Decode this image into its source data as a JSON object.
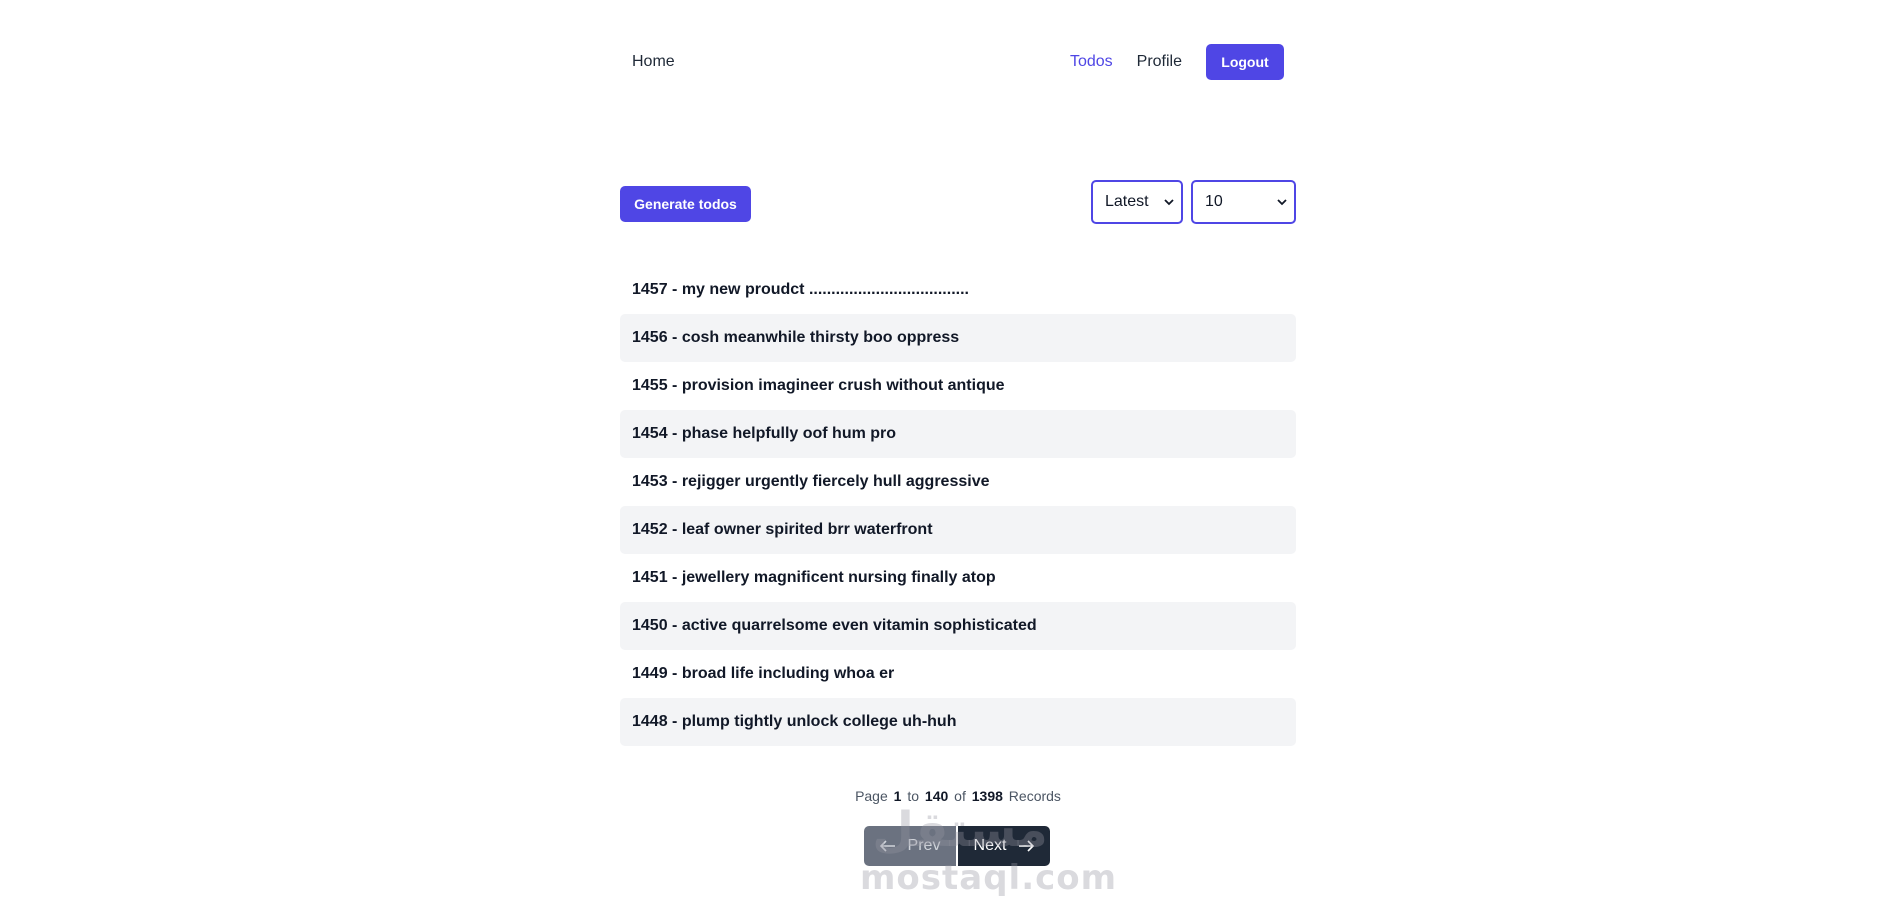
{
  "nav": {
    "home": "Home",
    "todos": "Todos",
    "profile": "Profile",
    "logout": "Logout"
  },
  "toolbar": {
    "generate_label": "Generate todos",
    "sort_selected": "Latest",
    "page_size_selected": "10"
  },
  "todos": [
    {
      "text": "1457 - my new proudct ...................................."
    },
    {
      "text": "1456 - cosh meanwhile thirsty boo oppress"
    },
    {
      "text": "1455 - provision imagineer crush without antique"
    },
    {
      "text": "1454 - phase helpfully oof hum pro"
    },
    {
      "text": "1453 - rejigger urgently fiercely hull aggressive"
    },
    {
      "text": "1452 - leaf owner spirited brr waterfront"
    },
    {
      "text": "1451 - jewellery magnificent nursing finally atop"
    },
    {
      "text": "1450 - active quarrelsome even vitamin sophisticated"
    },
    {
      "text": "1449 - broad life including whoa er"
    },
    {
      "text": "1448 - plump tightly unlock college uh-huh"
    }
  ],
  "pagination": {
    "page_label": "Page",
    "current": "1",
    "to_label": "to",
    "total_pages": "140",
    "of_label": "of",
    "total_records": "1398",
    "records_label": "Records",
    "prev_label": "Prev",
    "next_label": "Next"
  },
  "watermark": {
    "arabic": "مستقل",
    "latin": "mostaql.com"
  },
  "colors": {
    "accent": "#4f46e5",
    "row_alt": "#f3f4f6",
    "next_bg": "#1f2937",
    "prev_bg": "#6b7280"
  }
}
